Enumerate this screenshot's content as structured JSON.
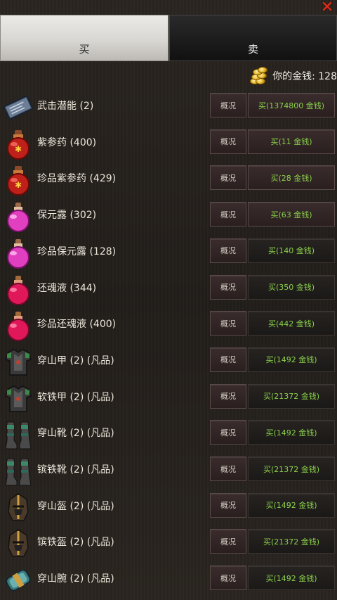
{
  "tabs": {
    "buy_label": "买",
    "sell_label": "卖"
  },
  "money_label": "你的金钱: 128",
  "info_label": "概况",
  "items": [
    {
      "name": "武击潜能 (2)",
      "buy": "买(1374800 金钱)",
      "icon": "book-icon"
    },
    {
      "name": "紫参药 (400)",
      "buy": "买(11 金钱)",
      "icon": "red-potion-icon"
    },
    {
      "name": "珍品紫参药 (429)",
      "buy": "买(28 金钱)",
      "icon": "red-potion-icon"
    },
    {
      "name": "保元露 (302)",
      "buy": "买(63 金钱)",
      "icon": "pink-potion-icon"
    },
    {
      "name": "珍品保元露 (128)",
      "buy": "买(140 金钱)",
      "icon": "pink-potion-icon"
    },
    {
      "name": "还魂液 (344)",
      "buy": "买(350 金钱)",
      "icon": "crimson-potion-icon"
    },
    {
      "name": "珍品还魂液 (400)",
      "buy": "买(442 金钱)",
      "icon": "crimson-potion-icon"
    },
    {
      "name": "穿山甲 (2) (凡品)",
      "buy": "买(1492 金钱)",
      "icon": "armor-icon"
    },
    {
      "name": "软铁甲 (2) (凡品)",
      "buy": "买(21372 金钱)",
      "icon": "armor-icon"
    },
    {
      "name": "穿山靴 (2) (凡品)",
      "buy": "买(1492 金钱)",
      "icon": "boots-icon"
    },
    {
      "name": "镔铁靴 (2) (凡品)",
      "buy": "买(21372 金钱)",
      "icon": "boots-icon"
    },
    {
      "name": "穿山盔 (2) (凡品)",
      "buy": "买(1492 金钱)",
      "icon": "helmet-icon"
    },
    {
      "name": "镔铁盔 (2) (凡品)",
      "buy": "买(21372 金钱)",
      "icon": "helmet-icon"
    },
    {
      "name": "穿山腕 (2) (凡品)",
      "buy": "买(1492 金钱)",
      "icon": "bracer-icon"
    }
  ]
}
